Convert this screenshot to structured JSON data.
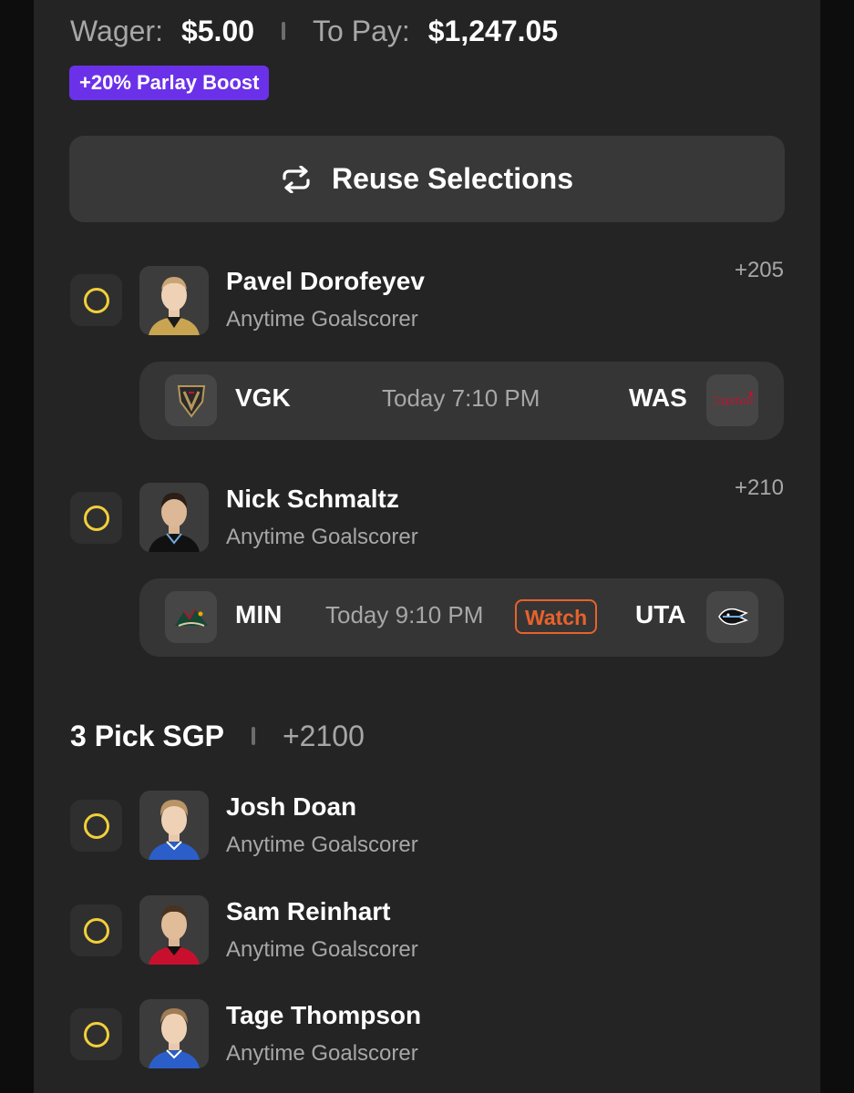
{
  "bet": {
    "wager_label": "Wager:",
    "wager_value": "$5.00",
    "topay_label": "To Pay:",
    "topay_value": "$1,247.05",
    "boost": "+20% Parlay Boost"
  },
  "reuse_button": {
    "label": "Reuse Selections",
    "icon": "repeat-icon"
  },
  "legs": [
    {
      "player": "Pavel Dorofeyev",
      "market": "Anytime Goalscorer",
      "odds": "+205",
      "jersey_color": "#c9a552",
      "game": {
        "away": "VGK",
        "time": "Today 7:10 PM",
        "home": "WAS",
        "watch": ""
      }
    },
    {
      "player": "Nick Schmaltz",
      "market": "Anytime Goalscorer",
      "odds": "+210",
      "jersey_color": "#111111",
      "game": {
        "away": "MIN",
        "time": "Today 9:10 PM",
        "home": "UTA",
        "watch": "Watch"
      }
    }
  ],
  "sgp": {
    "title": "3 Pick SGP",
    "odds": "+2100",
    "legs": [
      {
        "player": "Josh Doan",
        "market": "Anytime Goalscorer",
        "jersey_color": "#2b5ec9"
      },
      {
        "player": "Sam Reinhart",
        "market": "Anytime Goalscorer",
        "jersey_color": "#c8102e"
      },
      {
        "player": "Tage Thompson",
        "market": "Anytime Goalscorer",
        "jersey_color": "#2b5ec9"
      }
    ]
  },
  "colors": {
    "radio": "#f1cf3b",
    "boost_bg": "#6b31e8",
    "watch": "#e8622c",
    "panel_bg": "#242424"
  }
}
